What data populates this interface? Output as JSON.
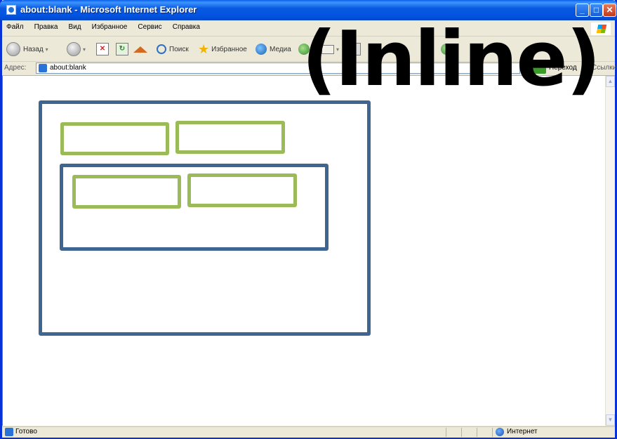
{
  "window": {
    "title": "about:blank - Microsoft Internet Explorer"
  },
  "menu": {
    "items": [
      "Файл",
      "Правка",
      "Вид",
      "Избранное",
      "Сервис",
      "Справка"
    ]
  },
  "toolbar": {
    "back_label": "Назад",
    "search_label": "Поиск",
    "favorites_label": "Избранное",
    "media_label": "Медиа"
  },
  "address": {
    "label": "Адрес:",
    "value": "about:blank",
    "go_label": "Переход",
    "links_label": "Ссылки"
  },
  "status": {
    "text": "Готово",
    "zone": "Интернет"
  },
  "overlay": {
    "text": "(Inline)"
  },
  "colors": {
    "container_border": "#3f6591",
    "inline_border": "#9bbb59"
  }
}
